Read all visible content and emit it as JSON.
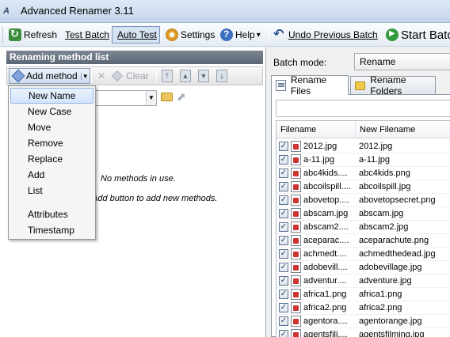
{
  "window": {
    "title": "Advanced Renamer 3.11",
    "icon": "advanced-renamer-logo"
  },
  "toolbar": {
    "refresh": "Refresh",
    "test_batch": "Test Batch",
    "auto_test": "Auto Test",
    "settings": "Settings",
    "help": "Help",
    "help_arrow": "▾",
    "undo_previous_batch": "Undo Previous Batch",
    "start_batch": "Start Batc"
  },
  "left_panel": {
    "header": "Renaming method list",
    "add_method": "Add method",
    "clear": "Clear",
    "empty_message": "No methods in use.",
    "empty_hint": "Add button to add new methods."
  },
  "add_method_menu": {
    "items": [
      "New Name",
      "New Case",
      "Move",
      "Remove",
      "Replace",
      "Add",
      "List"
    ],
    "items_after_separator": [
      "Attributes",
      "Timestamp"
    ],
    "highlighted": "New Name"
  },
  "right_panel": {
    "batch_mode_label": "Batch mode:",
    "batch_mode_value": "Rename",
    "tabs": [
      "Rename Files",
      "Rename Folders"
    ],
    "active_tab": "Rename Files"
  },
  "file_list": {
    "columns": [
      "Filename",
      "New Filename"
    ],
    "rows": [
      {
        "filename": "2012.jpg",
        "new": "2012.jpg",
        "checked": true
      },
      {
        "filename": "a-11.jpg",
        "new": "a-11.jpg",
        "checked": true
      },
      {
        "filename": "abc4kids....",
        "new": "abc4kids.png",
        "checked": true
      },
      {
        "filename": "abcoilspill....",
        "new": "abcoilspill.jpg",
        "checked": true
      },
      {
        "filename": "abovetop....",
        "new": "abovetopsecret.png",
        "checked": true
      },
      {
        "filename": "abscam.jpg",
        "new": "abscam.jpg",
        "checked": true
      },
      {
        "filename": "abscam2....",
        "new": "abscam2.jpg",
        "checked": true
      },
      {
        "filename": "aceparac....",
        "new": "aceparachute.png",
        "checked": true
      },
      {
        "filename": "achmedt....",
        "new": "achmedthedead.jpg",
        "checked": true
      },
      {
        "filename": "adobevill....",
        "new": "adobevillage.jpg",
        "checked": true
      },
      {
        "filename": "adventur....",
        "new": "adventure.jpg",
        "checked": true
      },
      {
        "filename": "africa1.png",
        "new": "africa1.png",
        "checked": true
      },
      {
        "filename": "africa2.png",
        "new": "africa2.png",
        "checked": true
      },
      {
        "filename": "agentora....",
        "new": "agentorange.jpg",
        "checked": true
      },
      {
        "filename": "agentsfili....",
        "new": "agentsfilming.jpg",
        "checked": true
      }
    ]
  }
}
